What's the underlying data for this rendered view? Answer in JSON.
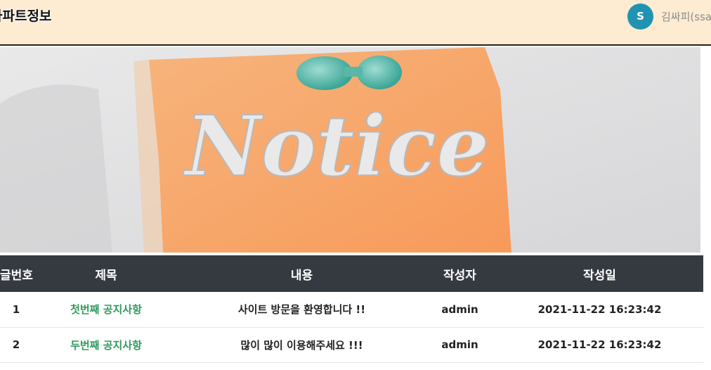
{
  "header": {
    "brand": "아파트정보",
    "avatar_initial": "S",
    "username": "김싸피(ssafy)"
  },
  "banner": {
    "text": "Notice"
  },
  "table": {
    "columns": [
      "글번호",
      "제목",
      "내용",
      "작성자",
      "작성일"
    ],
    "rows": [
      {
        "no": "1",
        "title": "첫번째 공지사항",
        "content": "사이트 방문을 환영합니다 !!",
        "author": "admin",
        "date": "2021-11-22 16:23:42"
      },
      {
        "no": "2",
        "title": "두번째 공지사항",
        "content": "많이 많이 이용해주세요 !!!",
        "author": "admin",
        "date": "2021-11-22 16:23:42"
      }
    ]
  },
  "colors": {
    "header_bg": "#fdebd2",
    "avatar": "#1f93b0",
    "table_head": "#343a40",
    "title_link": "#2e9b5f"
  }
}
